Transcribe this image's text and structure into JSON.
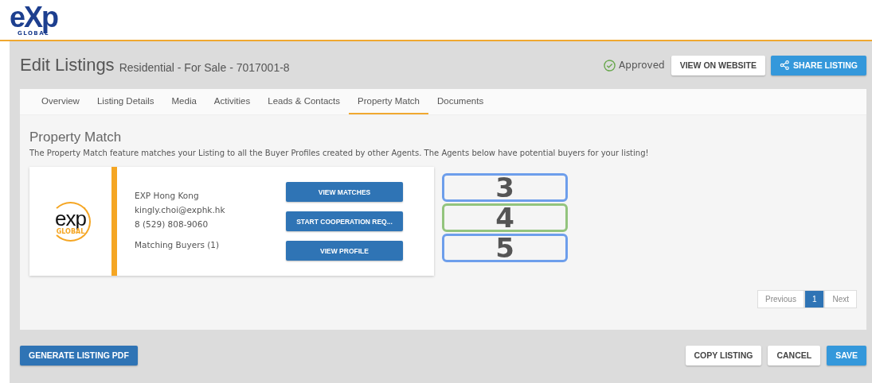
{
  "logo": {
    "mark": "eXp",
    "sub": "GLOBAL"
  },
  "header": {
    "title": "Edit Listings",
    "subtitle": "Residential - For Sale - 7017001-8",
    "status": "Approved",
    "buttons": [
      {
        "label": "VIEW ON WEBSITE",
        "kind": "secondary"
      },
      {
        "label": "SHARE LISTING",
        "kind": "share"
      }
    ]
  },
  "tabs": [
    {
      "label": "Overview",
      "selected": false
    },
    {
      "label": "Listing Details",
      "selected": false
    },
    {
      "label": "Media",
      "selected": false
    },
    {
      "label": "Activities",
      "selected": false
    },
    {
      "label": "Leads & Contacts",
      "selected": false
    },
    {
      "label": "Property Match",
      "selected": true
    },
    {
      "label": "Documents",
      "selected": false
    }
  ],
  "section": {
    "title": "Property Match",
    "description": "The Property Match feature matches your Listing to all the Buyer Profiles created by other Agents. The Agents below have potential buyers for your listing!"
  },
  "agent_card": {
    "logo": {
      "mark": "exp",
      "sub": "GLOBAL"
    },
    "name": "EXP Hong Kong",
    "email": "kingly.choi@exphk.hk",
    "phone": "8 (529) 808-9060",
    "matching": "Matching Buyers (1)",
    "buttons": [
      {
        "label": "VIEW MATCHES",
        "callout": "3",
        "color": "#6d9eeb"
      },
      {
        "label": "START COOPERATION REQ...",
        "callout": "4",
        "color": "#93c47d"
      },
      {
        "label": "VIEW PROFILE",
        "callout": "5",
        "color": "#6d9eeb"
      }
    ]
  },
  "pagination": {
    "previous": "Previous",
    "pages": [
      {
        "label": "1",
        "selected": true
      }
    ],
    "next": "Next"
  },
  "footer": {
    "left": "GENERATE LISTING PDF",
    "right": [
      {
        "label": "COPY LISTING",
        "kind": "secondary"
      },
      {
        "label": "CANCEL",
        "kind": "secondary"
      },
      {
        "label": "SAVE",
        "kind": "primary"
      }
    ]
  }
}
